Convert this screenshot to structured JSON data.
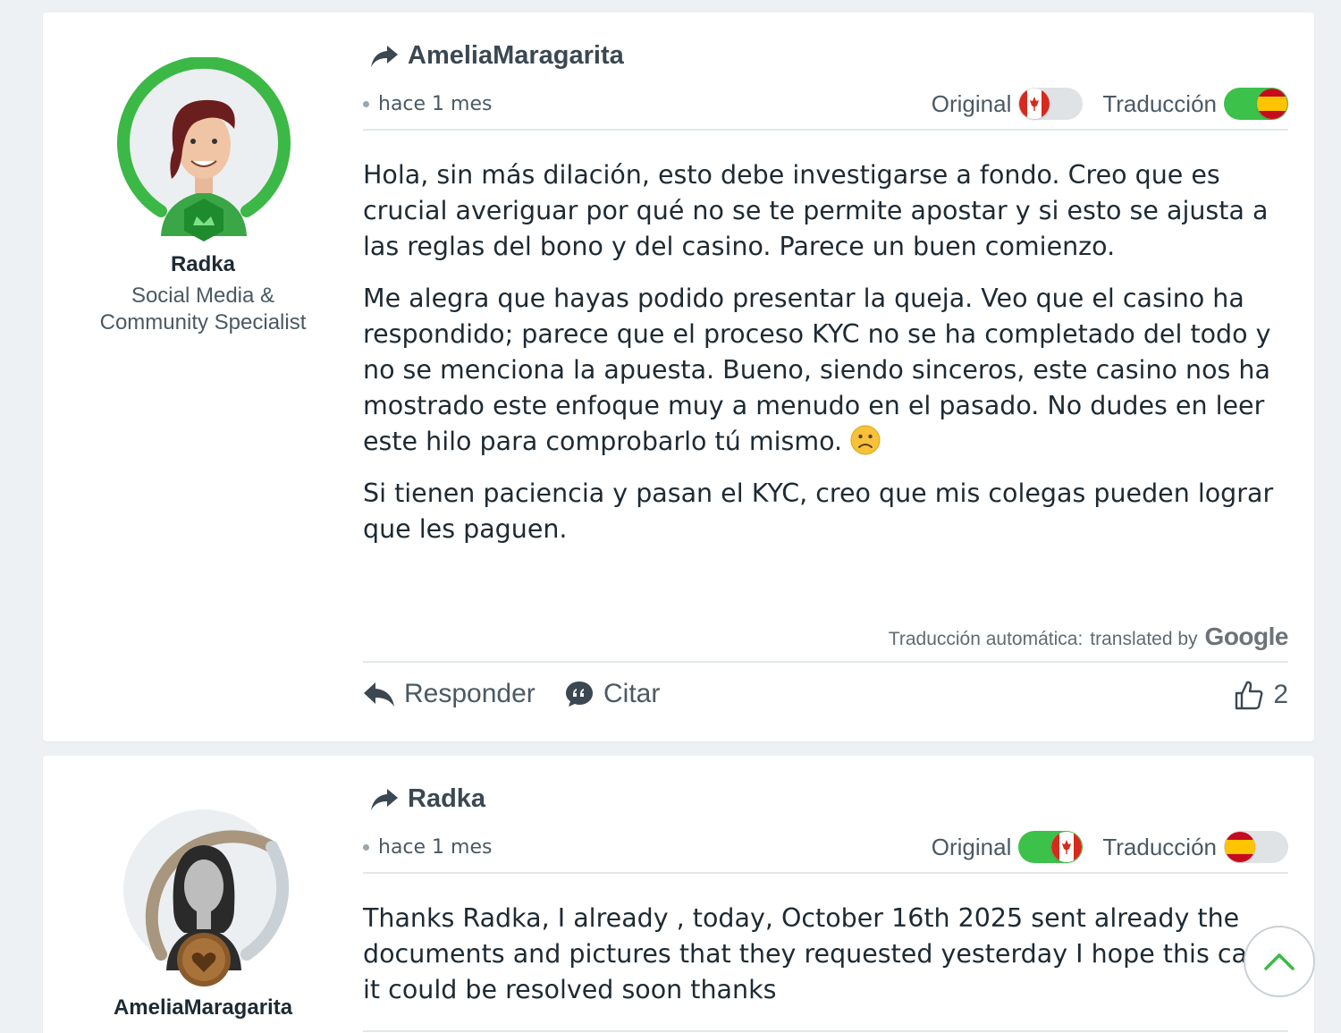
{
  "posts": [
    {
      "author": {
        "name": "Radka",
        "role_line1": "Social Media &",
        "role_line2": "Community Specialist"
      },
      "reply_to": "AmeliaMaragarita",
      "time": "hace 1 mes",
      "toggle_original_label": "Original",
      "toggle_translation_label": "Traducción",
      "active_mode": "Traducción",
      "paragraphs": [
        "Hola, sin más dilación, esto debe investigarse a fondo. Creo que es crucial averiguar por qué no se te permite apostar y si esto se ajusta a las reglas del bono y del casino. Parece un buen comienzo.",
        "Me alegra que hayas podido presentar la queja. Veo que el casino ha respondido; parece que el proceso KYC no se ha completado del todo y no se menciona la apuesta. Bueno, siendo sinceros, este casino nos ha mostrado este enfoque muy a menudo en el pasado. No dudes en leer este hilo para comprobarlo tú mismo.",
        "Si tienen paciencia y pasan el KYC, creo que mis colegas pueden lograr que les paguen."
      ],
      "translation_note": "Traducción automática:",
      "translated_by": "translated by",
      "google": "Google",
      "reply_label": "Responder",
      "quote_label": "Citar",
      "likes": "2"
    },
    {
      "author": {
        "name": "AmeliaMaragarita"
      },
      "reply_to": "Radka",
      "time": "hace 1 mes",
      "toggle_original_label": "Original",
      "toggle_translation_label": "Traducción",
      "active_mode": "Original",
      "paragraphs": [
        "Thanks Radka, I already , today, October 16th 2025 sent already the documents and pictures that they requested yesterday I hope this case it could be resolved soon thanks"
      ]
    }
  ],
  "colors": {
    "accent_green": "#3cc14a",
    "text_dark": "#1e2a33",
    "text_muted": "#4b5963"
  },
  "icons": [
    "share-icon",
    "canada-flag-icon",
    "spain-flag-icon",
    "reply-icon",
    "quote-icon",
    "thumbs-up-icon",
    "chevron-up-icon",
    "sad-face-emoji"
  ]
}
